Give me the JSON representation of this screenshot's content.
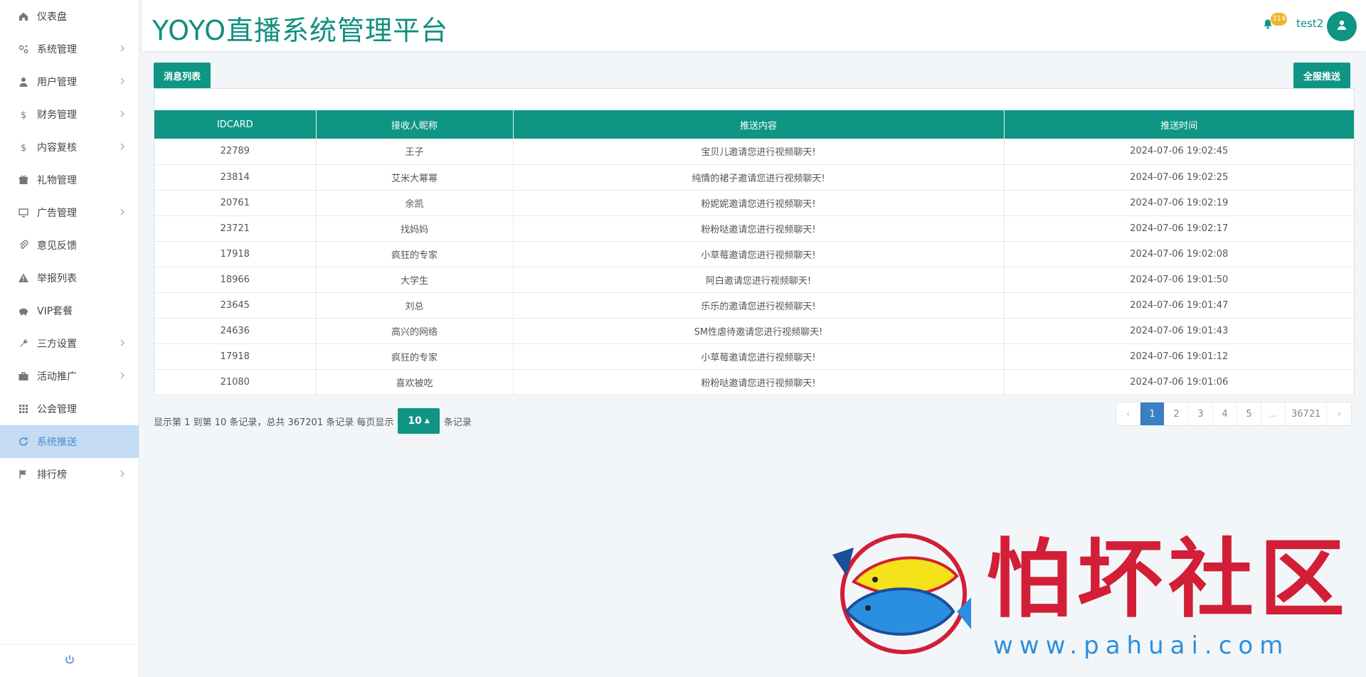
{
  "app": {
    "title": "YOYO直播系统管理平台"
  },
  "header": {
    "notification_count": "314",
    "username": "test2"
  },
  "sidebar": {
    "items": [
      {
        "label": "仪表盘",
        "icon": "home-icon",
        "has_children": false
      },
      {
        "label": "系统管理",
        "icon": "settings-icon",
        "has_children": true
      },
      {
        "label": "用户管理",
        "icon": "user-icon",
        "has_children": true
      },
      {
        "label": "财务管理",
        "icon": "dollar-icon",
        "has_children": true
      },
      {
        "label": "内容复核",
        "icon": "dollar-icon",
        "has_children": true
      },
      {
        "label": "礼物管理",
        "icon": "gift-icon",
        "has_children": false
      },
      {
        "label": "广告管理",
        "icon": "monitor-icon",
        "has_children": true
      },
      {
        "label": "意见反馈",
        "icon": "paperclip-icon",
        "has_children": false
      },
      {
        "label": "举报列表",
        "icon": "warning-icon",
        "has_children": false
      },
      {
        "label": "VIP套餐",
        "icon": "piggy-bank-icon",
        "has_children": false
      },
      {
        "label": "三方设置",
        "icon": "wrench-icon",
        "has_children": true
      },
      {
        "label": "活动推广",
        "icon": "briefcase-icon",
        "has_children": true
      },
      {
        "label": "公会管理",
        "icon": "grid-icon",
        "has_children": false
      },
      {
        "label": "系统推送",
        "icon": "refresh-icon",
        "has_children": false,
        "active": true
      },
      {
        "label": "排行榜",
        "icon": "flag-icon",
        "has_children": true
      }
    ],
    "footer_icon": "power-icon"
  },
  "toolbar": {
    "list_button": "消息列表",
    "push_all_button": "全服推送"
  },
  "table": {
    "columns": [
      "IDCARD",
      "接收人昵称",
      "推送内容",
      "推送时间"
    ],
    "rows": [
      [
        "22789",
        "王子",
        "宝贝儿邀请您进行视频聊天!",
        "2024-07-06 19:02:45"
      ],
      [
        "23814",
        "艾米大幂幂",
        "纯情的裙子邀请您进行视频聊天!",
        "2024-07-06 19:02:25"
      ],
      [
        "20761",
        "余凯",
        "粉妮妮邀请您进行视频聊天!",
        "2024-07-06 19:02:19"
      ],
      [
        "23721",
        "找妈妈",
        "粉粉哒邀请您进行视频聊天!",
        "2024-07-06 19:02:17"
      ],
      [
        "17918",
        "疯狂的专家",
        "小草莓邀请您进行视频聊天!",
        "2024-07-06 19:02:08"
      ],
      [
        "18966",
        "大学生",
        "阿白邀请您进行视频聊天!",
        "2024-07-06 19:01:50"
      ],
      [
        "23645",
        "刘总",
        "乐乐的邀请您进行视频聊天!",
        "2024-07-06 19:01:47"
      ],
      [
        "24636",
        "高兴的网络",
        "SM性虐待邀请您进行视频聊天!",
        "2024-07-06 19:01:43"
      ],
      [
        "17918",
        "疯狂的专家",
        "小草莓邀请您进行视频聊天!",
        "2024-07-06 19:01:12"
      ],
      [
        "21080",
        "喜欢被吃",
        "粉粉哒邀请您进行视频聊天!",
        "2024-07-06 19:01:06"
      ]
    ]
  },
  "footer": {
    "info_prefix": "显示第 1 到第 10 条记录，总共 367201 条记录 每页显示",
    "page_size": "10",
    "info_suffix": "条记录"
  },
  "pagination": {
    "prev": "‹",
    "pages": [
      "1",
      "2",
      "3",
      "4",
      "5",
      "...",
      "36721"
    ],
    "active": "1",
    "next": "›"
  },
  "watermark": {
    "text": "怕坏社区",
    "url": "www.pahuai.com"
  },
  "colors": {
    "primary": "#0f9583",
    "active_page": "#3a7fc1",
    "sidebar_active": "#c3dcf3",
    "badge": "#f2b328",
    "watermark_red": "#d21e36",
    "watermark_blue": "#2a8fe0"
  }
}
